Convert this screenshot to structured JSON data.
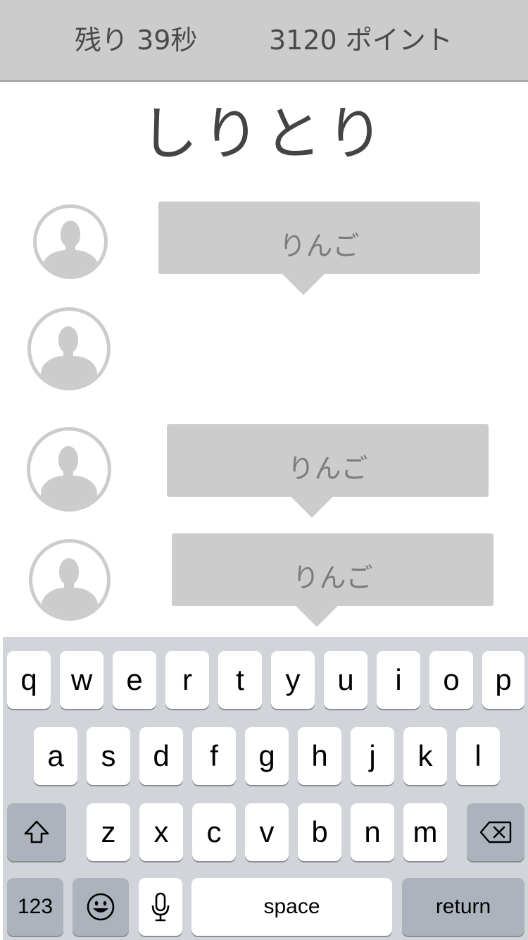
{
  "header": {
    "time_left": "残り 39秒",
    "points": "3120 ポイント"
  },
  "title": "しりとり",
  "messages": [
    {
      "text": "りんご"
    },
    {
      "text": ""
    },
    {
      "text": "りんご"
    },
    {
      "text": "りんご"
    }
  ],
  "keyboard": {
    "row1": [
      "q",
      "w",
      "e",
      "r",
      "t",
      "y",
      "u",
      "i",
      "o",
      "p"
    ],
    "row2": [
      "a",
      "s",
      "d",
      "f",
      "g",
      "h",
      "j",
      "k",
      "l"
    ],
    "row3": [
      "z",
      "x",
      "c",
      "v",
      "b",
      "n",
      "m"
    ],
    "numbers_label": "123",
    "space_label": "space",
    "return_label": "return",
    "icons": [
      "shift-icon",
      "backspace-icon",
      "emoji-icon",
      "microphone-icon"
    ]
  },
  "colors": {
    "header_bg": "#cccccc",
    "bubble_bg": "#cccccc",
    "keyboard_bg": "#d1d4d9",
    "key_bg": "#ffffff",
    "fn_key_bg": "#acb3bd"
  }
}
